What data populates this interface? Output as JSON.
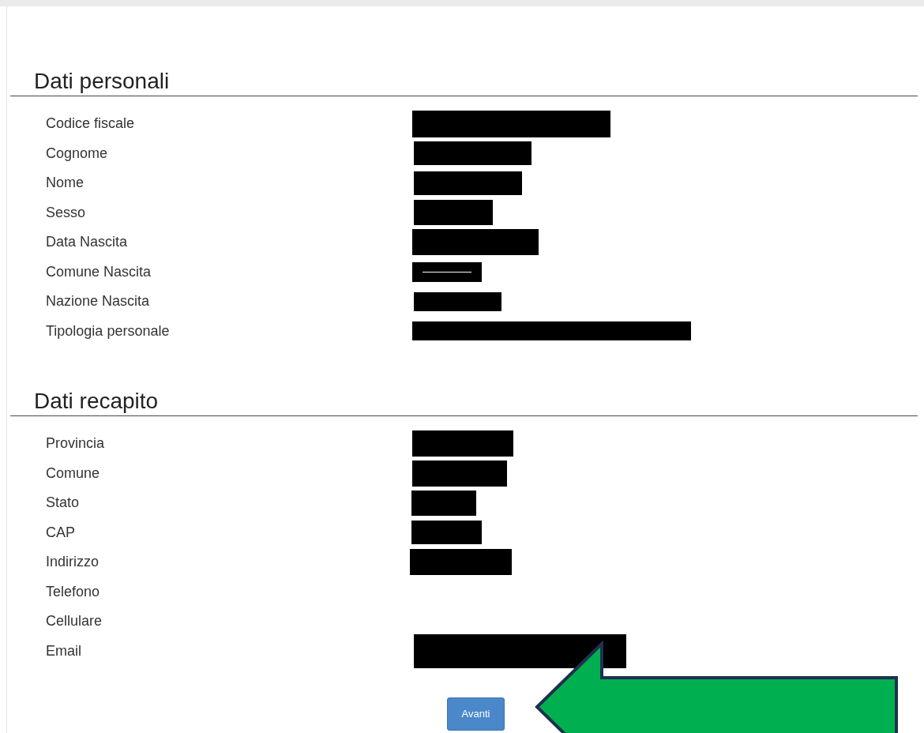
{
  "sections": [
    {
      "title": "Dati personali",
      "fields": [
        {
          "label": "Codice fiscale",
          "redacted": true
        },
        {
          "label": "Cognome",
          "redacted": true
        },
        {
          "label": "Nome",
          "redacted": true
        },
        {
          "label": "Sesso",
          "redacted": true
        },
        {
          "label": "Data Nascita",
          "redacted": true
        },
        {
          "label": "Comune Nascita",
          "redacted": true
        },
        {
          "label": "Nazione Nascita",
          "redacted": true
        },
        {
          "label": "Tipologia personale",
          "redacted": true
        }
      ]
    },
    {
      "title": "Dati recapito",
      "fields": [
        {
          "label": "Provincia",
          "redacted": true
        },
        {
          "label": "Comune",
          "redacted": true
        },
        {
          "label": "Stato",
          "redacted": true
        },
        {
          "label": "CAP",
          "redacted": true
        },
        {
          "label": "Indirizzo",
          "redacted": true
        },
        {
          "label": "Telefono",
          "redacted": false
        },
        {
          "label": "Cellulare",
          "redacted": false
        },
        {
          "label": "Email",
          "redacted": true
        }
      ]
    }
  ],
  "button": "Avanti"
}
